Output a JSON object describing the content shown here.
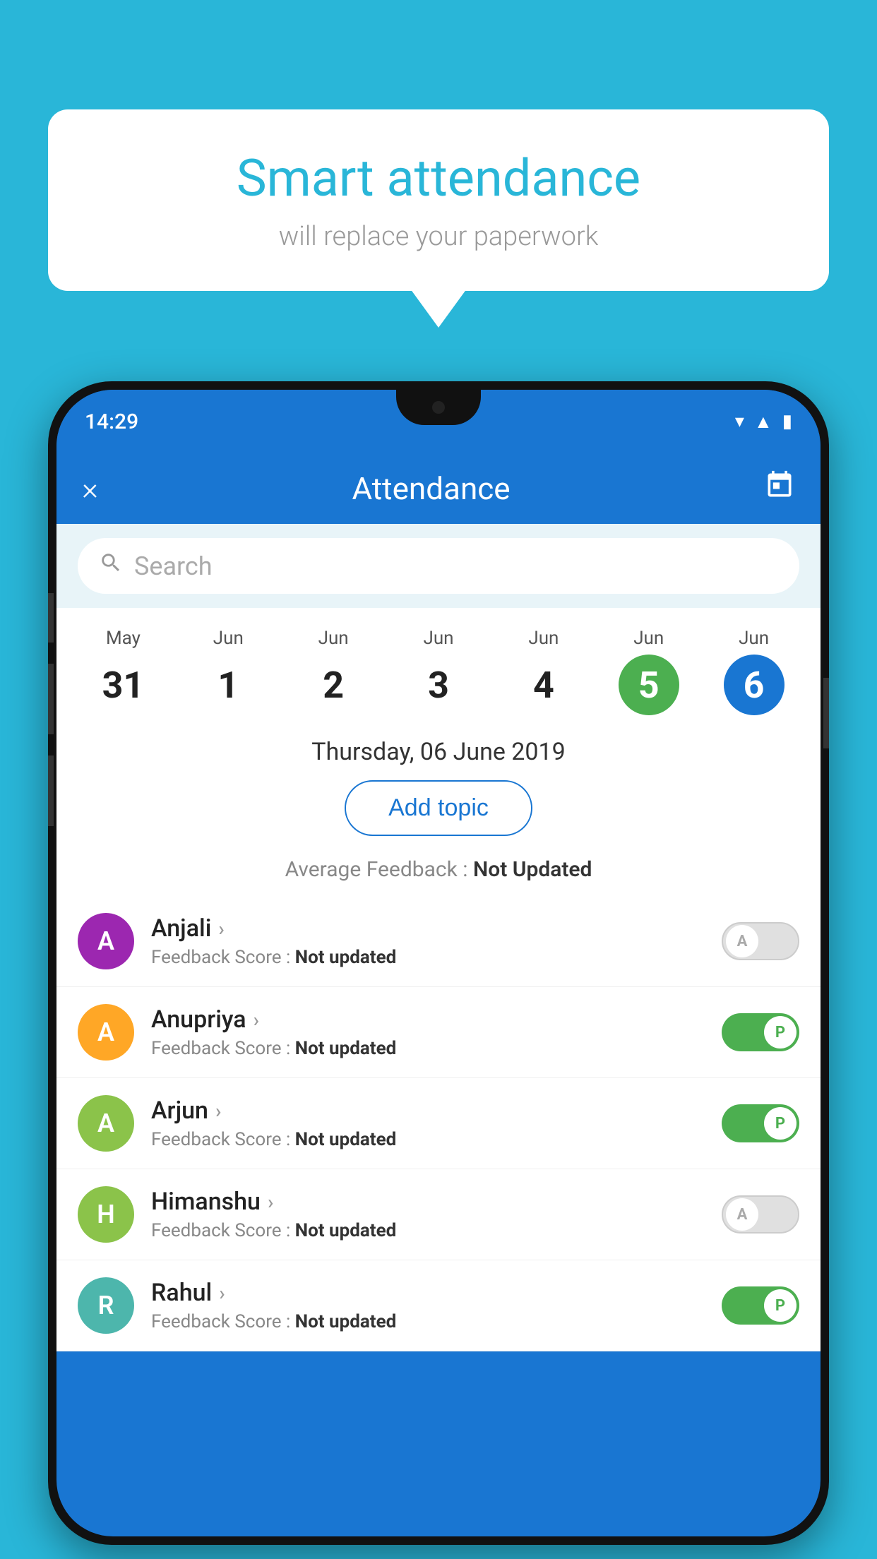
{
  "background_color": "#29b6d8",
  "bubble": {
    "title": "Smart attendance",
    "subtitle": "will replace your paperwork"
  },
  "status_bar": {
    "time": "14:29",
    "icons": [
      "wifi",
      "signal",
      "battery"
    ]
  },
  "header": {
    "close_label": "×",
    "title": "Attendance",
    "calendar_icon": "calendar"
  },
  "search": {
    "placeholder": "Search"
  },
  "calendar": {
    "days": [
      {
        "month": "May",
        "date": "31",
        "state": "normal"
      },
      {
        "month": "Jun",
        "date": "1",
        "state": "normal"
      },
      {
        "month": "Jun",
        "date": "2",
        "state": "normal"
      },
      {
        "month": "Jun",
        "date": "3",
        "state": "normal"
      },
      {
        "month": "Jun",
        "date": "4",
        "state": "normal"
      },
      {
        "month": "Jun",
        "date": "5",
        "state": "today"
      },
      {
        "month": "Jun",
        "date": "6",
        "state": "selected"
      }
    ],
    "selected_date_label": "Thursday, 06 June 2019"
  },
  "add_topic_label": "Add topic",
  "avg_feedback_label": "Average Feedback :",
  "avg_feedback_value": "Not Updated",
  "students": [
    {
      "name": "Anjali",
      "avatar_letter": "A",
      "avatar_color": "#9c27b0",
      "feedback_label": "Feedback Score :",
      "feedback_value": "Not updated",
      "toggle": "off",
      "toggle_letter": "A"
    },
    {
      "name": "Anupriya",
      "avatar_letter": "A",
      "avatar_color": "#ffa726",
      "feedback_label": "Feedback Score :",
      "feedback_value": "Not updated",
      "toggle": "on",
      "toggle_letter": "P"
    },
    {
      "name": "Arjun",
      "avatar_letter": "A",
      "avatar_color": "#8bc34a",
      "feedback_label": "Feedback Score :",
      "feedback_value": "Not updated",
      "toggle": "on",
      "toggle_letter": "P"
    },
    {
      "name": "Himanshu",
      "avatar_letter": "H",
      "avatar_color": "#8bc34a",
      "feedback_label": "Feedback Score :",
      "feedback_value": "Not updated",
      "toggle": "off",
      "toggle_letter": "A"
    },
    {
      "name": "Rahul",
      "avatar_letter": "R",
      "avatar_color": "#4db6ac",
      "feedback_label": "Feedback Score :",
      "feedback_value": "Not updated",
      "toggle": "on",
      "toggle_letter": "P"
    }
  ]
}
